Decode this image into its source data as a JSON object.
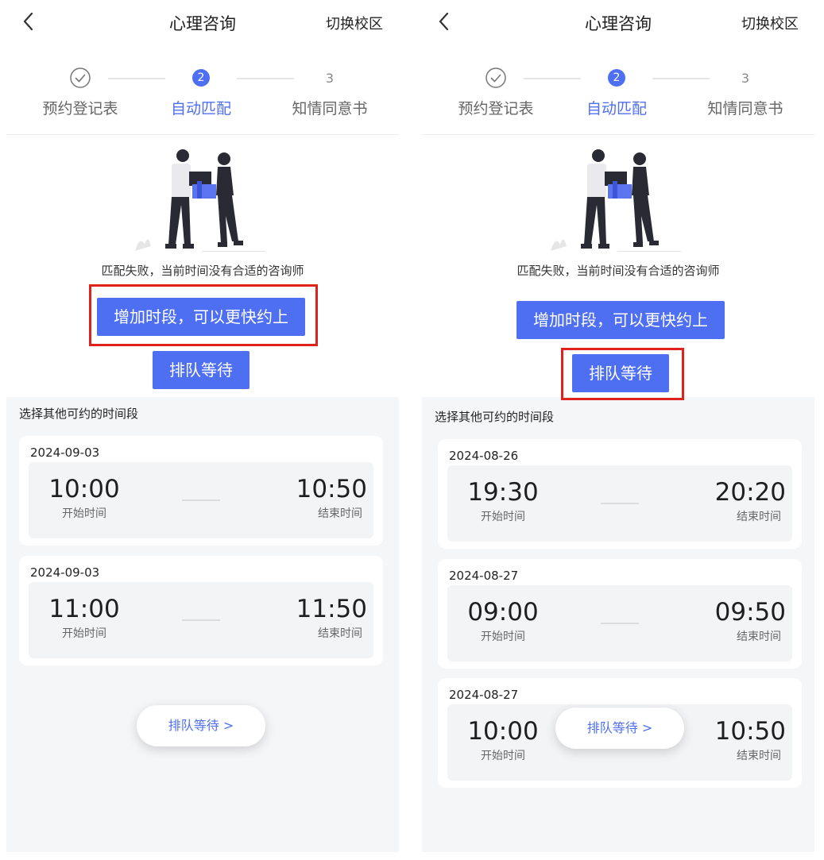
{
  "screens": [
    {
      "nav": {
        "title": "心理咨询",
        "campus_switch": "切换校区"
      },
      "steps": [
        {
          "label": "预约登记表",
          "state": "done"
        },
        {
          "label": "自动匹配",
          "state": "active",
          "number": "2"
        },
        {
          "label": "知情同意书",
          "state": "pending",
          "number": "3"
        }
      ],
      "match_message": "匹配失败，当前时间没有合适的咨询师",
      "add_time_button": "增加时段，可以更快约上",
      "queue_button": "排队等待",
      "other_slots_title": "选择其他可约的时间段",
      "slots": [
        {
          "date": "2024-09-03",
          "start": "10:00",
          "start_label": "开始时间",
          "end": "10:50",
          "end_label": "结束时间"
        },
        {
          "date": "2024-09-03",
          "start": "11:00",
          "start_label": "开始时间",
          "end": "11:50",
          "end_label": "结束时间"
        }
      ],
      "floating_queue": "排队等待 >"
    },
    {
      "nav": {
        "title": "心理咨询",
        "campus_switch": "切换校区"
      },
      "steps": [
        {
          "label": "预约登记表",
          "state": "done"
        },
        {
          "label": "自动匹配",
          "state": "active",
          "number": "2"
        },
        {
          "label": "知情同意书",
          "state": "pending",
          "number": "3"
        }
      ],
      "match_message": "匹配失败，当前时间没有合适的咨询师",
      "add_time_button": "增加时段，可以更快约上",
      "queue_button": "排队等待",
      "other_slots_title": "选择其他可约的时间段",
      "slots": [
        {
          "date": "2024-08-26",
          "start": "19:30",
          "start_label": "开始时间",
          "end": "20:20",
          "end_label": "结束时间"
        },
        {
          "date": "2024-08-27",
          "start": "09:00",
          "start_label": "开始时间",
          "end": "09:50",
          "end_label": "结束时间"
        },
        {
          "date": "2024-08-27",
          "start": "10:00",
          "start_label": "开始时间",
          "end": "10:50",
          "end_label": "结束时间"
        }
      ],
      "floating_queue": "排队等待 >"
    }
  ],
  "colors": {
    "accent": "#4f6ff2",
    "highlight": "#e0221e",
    "background": "#f5f6f8"
  },
  "icons": [
    "back-chevron-icon",
    "check-circle-icon",
    "illustration-people-exchange"
  ]
}
